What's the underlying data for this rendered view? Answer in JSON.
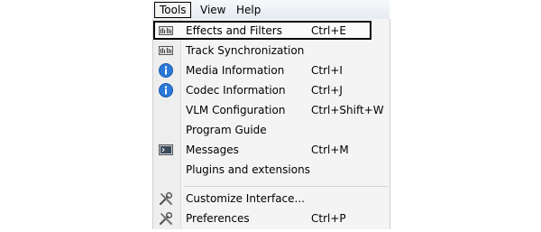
{
  "menubar": {
    "items": [
      {
        "label": "Tools",
        "active": true
      },
      {
        "label": "View",
        "active": false
      },
      {
        "label": "Help",
        "active": false
      }
    ]
  },
  "tools_menu": {
    "items": [
      {
        "label": "Effects and Filters",
        "shortcut": "Ctrl+E",
        "icon": "equalizer-icon",
        "highlighted": true
      },
      {
        "label": "Track Synchronization",
        "shortcut": "",
        "icon": "equalizer-icon"
      },
      {
        "label": "Media Information",
        "shortcut": "Ctrl+I",
        "icon": "info-icon"
      },
      {
        "label": "Codec Information",
        "shortcut": "Ctrl+J",
        "icon": "info-icon"
      },
      {
        "label": "VLM Configuration",
        "shortcut": "Ctrl+Shift+W",
        "icon": ""
      },
      {
        "label": "Program Guide",
        "shortcut": "",
        "icon": ""
      },
      {
        "label": "Messages",
        "shortcut": "Ctrl+M",
        "icon": "terminal-icon"
      },
      {
        "label": "Plugins and extensions",
        "shortcut": "",
        "icon": ""
      },
      {
        "label": "Customize Interface...",
        "shortcut": "",
        "icon": "tools-icon"
      },
      {
        "label": "Preferences",
        "shortcut": "Ctrl+P",
        "icon": "tools-icon"
      }
    ]
  },
  "colors": {
    "info_icon": "#2b78d8",
    "highlight_border": "#000000"
  }
}
